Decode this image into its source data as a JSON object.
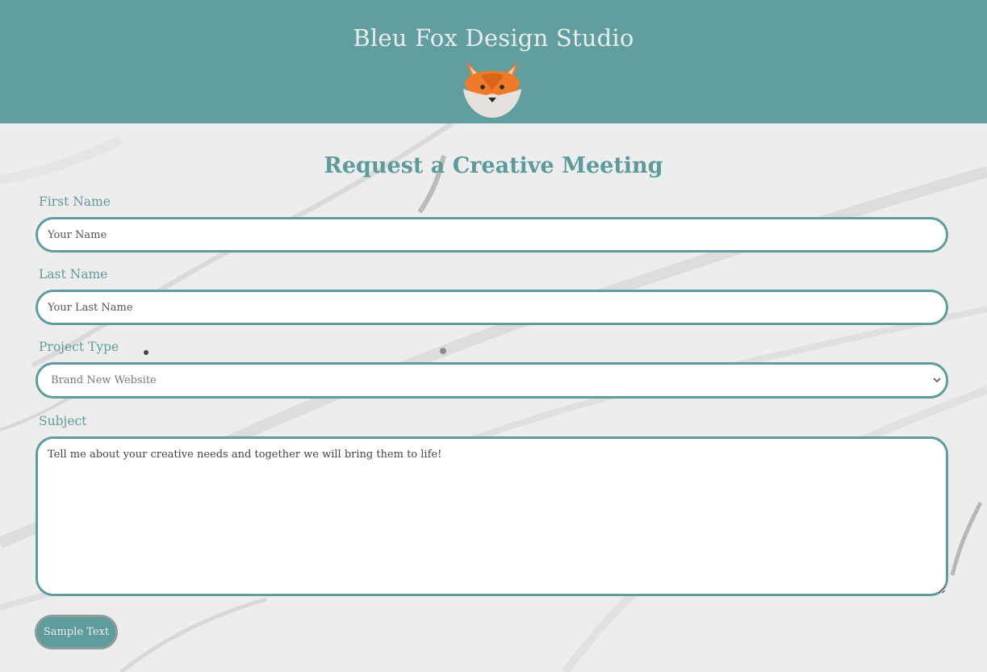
{
  "header": {
    "title": "Bleu Fox Design Studio",
    "logo_icon": "fox-logo-icon"
  },
  "form": {
    "heading": "Request a Creative Meeting",
    "first_name": {
      "label": "First Name",
      "placeholder": "Your Name"
    },
    "last_name": {
      "label": "Last Name",
      "placeholder": "Your Last Name"
    },
    "project_type": {
      "label": "Project Type",
      "selected": "Brand New Website"
    },
    "subject": {
      "label": "Subject",
      "placeholder": "Tell me about your creative needs and together we will bring them to life!"
    },
    "submit_label": "Sample Text"
  },
  "colors": {
    "header_bg": "#619e9f",
    "accent": "#5f9c9d",
    "header_text": "#e9eceb",
    "fox_orange": "#ee7a2a",
    "fox_white": "#e6e1dc"
  }
}
